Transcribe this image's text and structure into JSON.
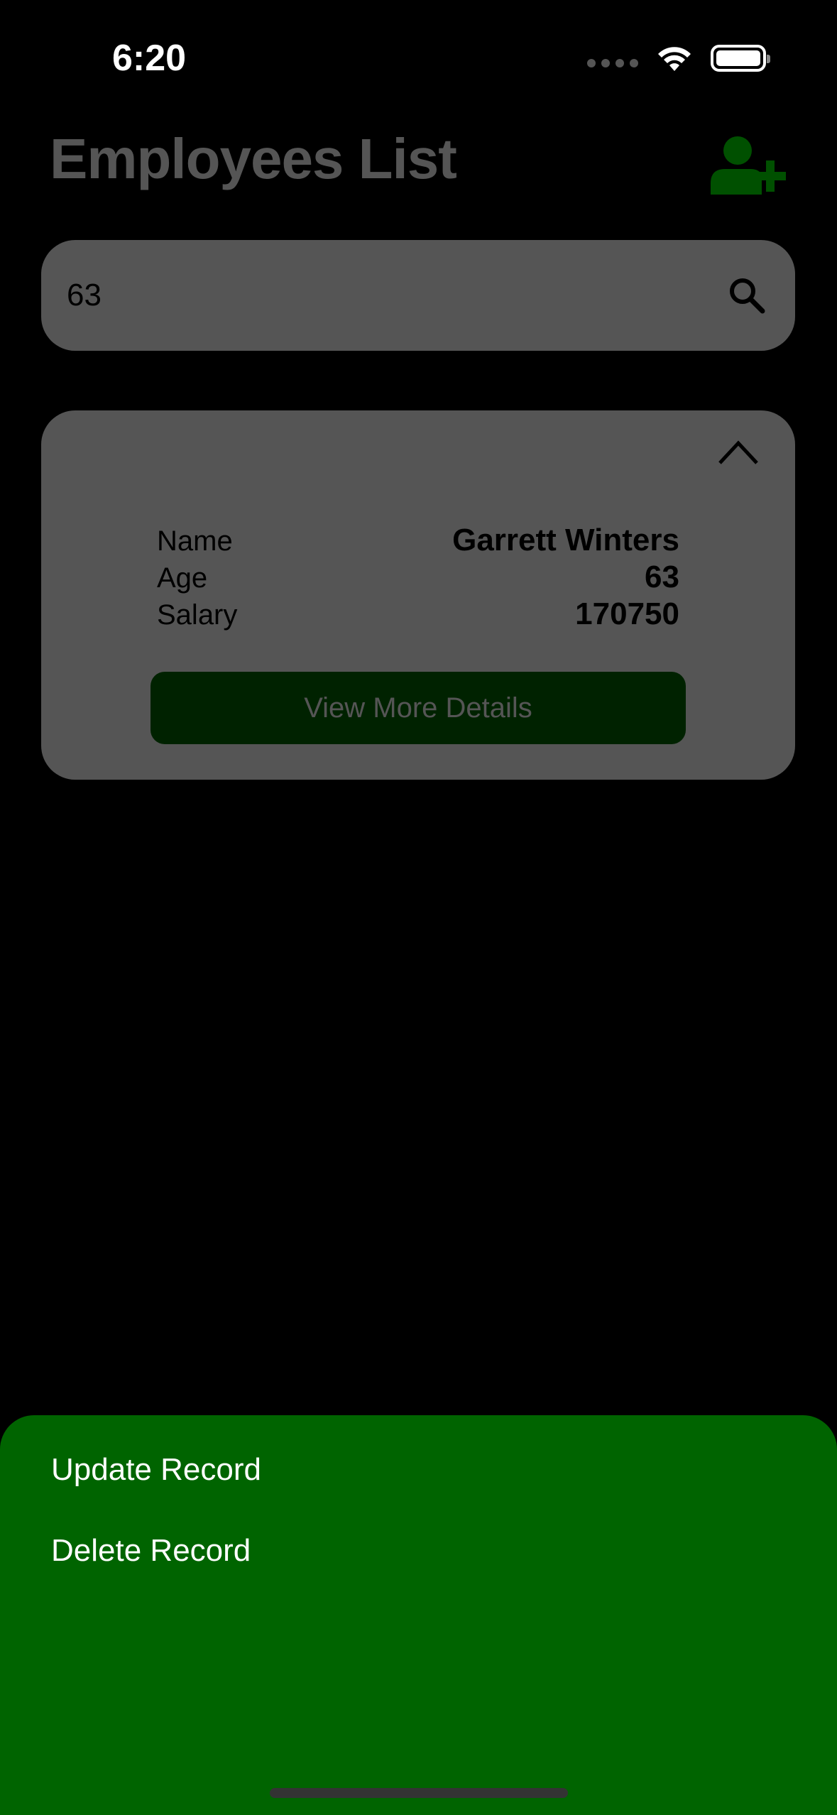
{
  "status_bar": {
    "time": "6:20"
  },
  "header": {
    "title": "Employees List",
    "add_icon": "add-user-icon"
  },
  "search": {
    "value": "63",
    "icon": "search-icon"
  },
  "employee_card": {
    "expanded": true,
    "name_label": "Name",
    "name_value": "Garrett Winters",
    "age_label": "Age",
    "age_value": "63",
    "salary_label": "Salary",
    "salary_value": "170750",
    "button_label": "View More Details"
  },
  "bottom_sheet": {
    "items": [
      {
        "label": "Update Record"
      },
      {
        "label": "Delete Record"
      }
    ]
  },
  "colors": {
    "background": "#000000",
    "dimmed_surface": "#555555",
    "dimmed_accent": "#002200",
    "sheet": "#006400",
    "dimmed_icon": "#005000"
  }
}
